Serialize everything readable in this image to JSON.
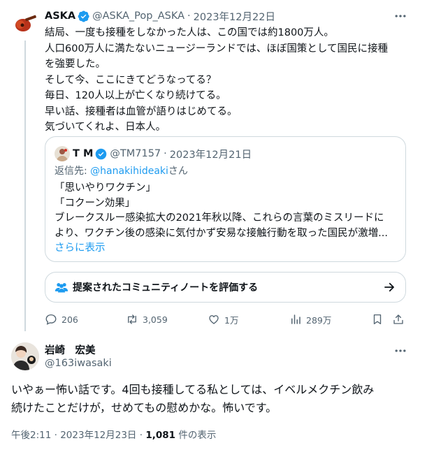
{
  "tweet1": {
    "author_name": "ASKA",
    "author_handle": "@ASKA_Pop_ASKA",
    "separator": "·",
    "date": "2023年12月22日",
    "lines": [
      "結局、一度も接種をしなかった人は、この国では約1800万人。",
      "人口600万人に満たないニュージーランドでは、ほぼ国策として国民に接種",
      "を強要した。",
      "そして今、ここにきてどうなってる？",
      "毎日、120人以上が亡くなり続けてる。",
      "早い話、接種者は血管が語りはじめてる。",
      "気づいてくれよ、日本人。"
    ],
    "quote": {
      "author_name": "T M",
      "author_handle": "@TM7157",
      "date": "2023年12月21日",
      "reply_prefix": "返信先: ",
      "reply_to": "@hanakihideaki",
      "reply_suffix": "さん",
      "lines": [
        "「思いやりワクチン」",
        "「コクーン効果」",
        "ブレークスルー感染拡大の2021年秋以降、これらの言葉のミスリードに",
        "より、ワクチン後の感染に気付かず安易な接触行動を取った国民が激増..."
      ],
      "show_more": "さらに表示"
    },
    "community_note": "提案されたコミュニティノートを評価する",
    "stats": {
      "replies": "206",
      "reposts": "3,059",
      "likes": "1万",
      "views": "289万"
    }
  },
  "tweet2": {
    "author_name": "岩崎　宏美",
    "author_handle": "@163iwasaki",
    "lines": [
      "いやぁー怖い話です。4回も接種してる私としては、イベルメクチン飲み",
      "続けたことだけが，せめてもの慰めかな。怖いです。"
    ],
    "time": "午後2:11",
    "separator": "·",
    "date": "2023年12月23日",
    "views_count": "1,081",
    "views_label": " 件の表示"
  },
  "colors": {
    "text": "#0f1419",
    "muted": "#536471",
    "accent": "#1d9bf0",
    "border": "#cfd9de"
  }
}
